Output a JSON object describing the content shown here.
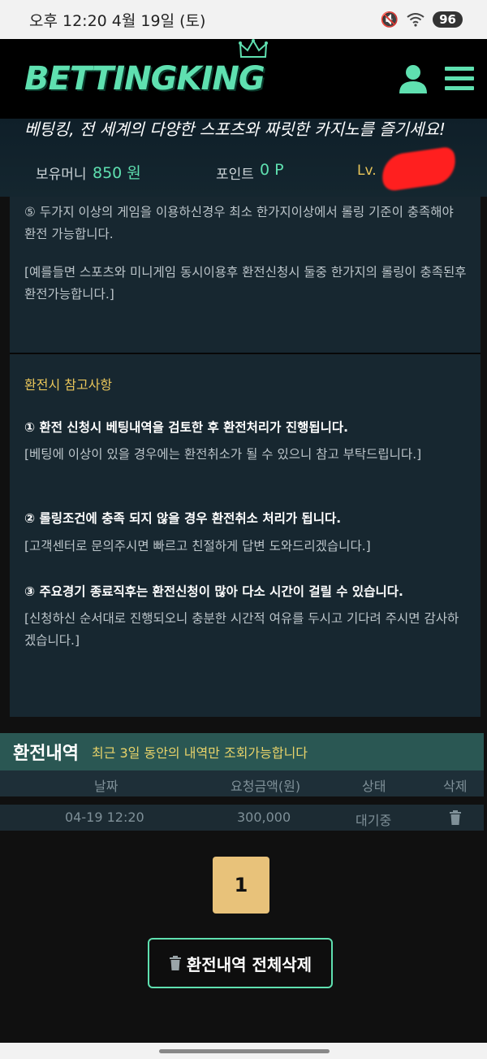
{
  "status": {
    "time": "오후 12:20  4월 19일 (토)",
    "battery": "96"
  },
  "header": {
    "logo": "BETTINGKING"
  },
  "hero": {
    "tagline": "베팅킹, 전 세계의 다양한 스포츠와 짜릿한 카지노를 즐기세요!",
    "money_label": "보유머니",
    "money_value": "850 원",
    "point_label": "포인트",
    "point_value": "0 P",
    "level_label": "Lv."
  },
  "notice1": {
    "line1": "⑤ 두가지 이상의 게임을 이용하신경우 최소 한가지이상에서 롤링 기준이 충족해야 환전 가능합니다.",
    "line2": "[예를들면 스포츠와 미니게임 동시이용후 환전신청시 둘중 한가지의 롤링이 충족된후 환전가능합니다.]"
  },
  "notice2": {
    "heading": "환전시 참고사항",
    "rule1": "① 환전 신청시 베팅내역을 검토한 후 환전처리가 진행됩니다.",
    "note1": "[베팅에 이상이 있을 경우에는 환전취소가 될 수 있으니 참고 부탁드립니다.]",
    "rule2": "② 롤링조건에 충족 되지 않을 경우 환전취소 처리가 됩니다.",
    "note2": "[고객센터로 문의주시면 빠르고 친절하게 답변 도와드리겠습니다.]",
    "rule3": "③ 주요경기 종료직후는 환전신청이 많아 다소 시간이 걸릴 수 있습니다.",
    "note3": "[신청하신 순서대로 진행되오니 충분한 시간적 여유를 두시고 기다려 주시면 감사하겠습니다.]"
  },
  "history": {
    "title": "환전내역",
    "subtitle": "최근 3일 동안의 내역만 조회가능합니다",
    "columns": [
      "날짜",
      "요청금액(원)",
      "상태",
      "삭제"
    ],
    "rows": [
      {
        "date": "04-19 12:20",
        "amount": "300,000",
        "status": "대기중"
      }
    ]
  },
  "pagination": {
    "current": "1"
  },
  "delete_all_label": "환전내역 전체삭제",
  "colors": {
    "accent": "#5fe0b0",
    "gold": "#e8c55a",
    "panel": "#172730",
    "header_bar": "#2a5753"
  },
  "icons": [
    "wifi-icon",
    "mute-icon",
    "user-icon",
    "menu-icon",
    "crown-icon",
    "trash-icon"
  ]
}
